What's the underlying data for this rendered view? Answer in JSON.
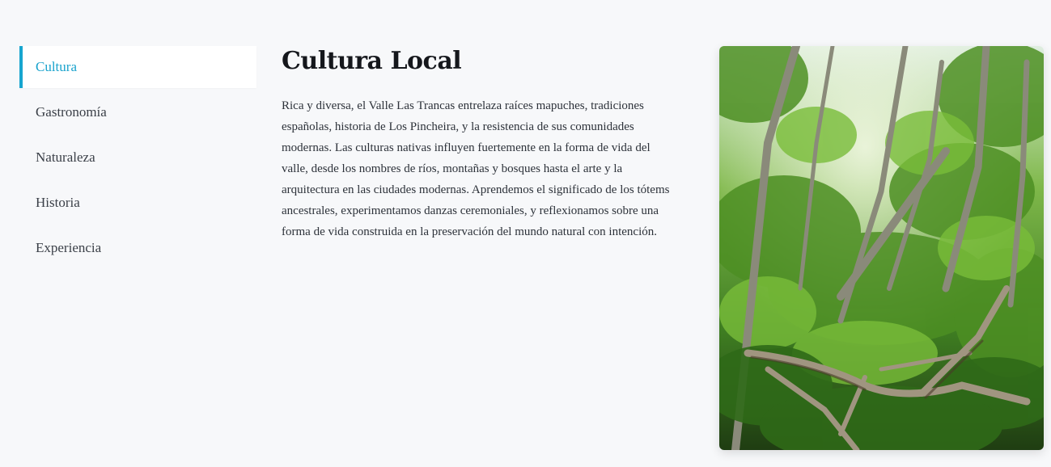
{
  "sidebar": {
    "items": [
      {
        "label": "Cultura",
        "active": true
      },
      {
        "label": "Gastronomía",
        "active": false
      },
      {
        "label": "Naturaleza",
        "active": false
      },
      {
        "label": "Historia",
        "active": false
      },
      {
        "label": "Experiencia",
        "active": false
      }
    ]
  },
  "main": {
    "title": "Cultura Local",
    "body": "Rica y diversa, el Valle Las Trancas entrelaza raíces mapuches, tradiciones españolas, historia de Los Pincheira, y la resistencia de sus comunidades modernas. Las culturas nativas influyen fuertemente en la forma de vida del valle, desde los nombres de ríos, montañas y bosques hasta el arte y la arquitectura en las ciudades modernas. Aprendemos el significado de los tótems ancestrales, experimentamos danzas ceremoniales, y reflexionamos sobre una forma de vida construida en la preservación del mundo natural con intención."
  },
  "colors": {
    "accent": "#17a5cf",
    "background": "#f7f8fa",
    "title": "#15171c"
  }
}
